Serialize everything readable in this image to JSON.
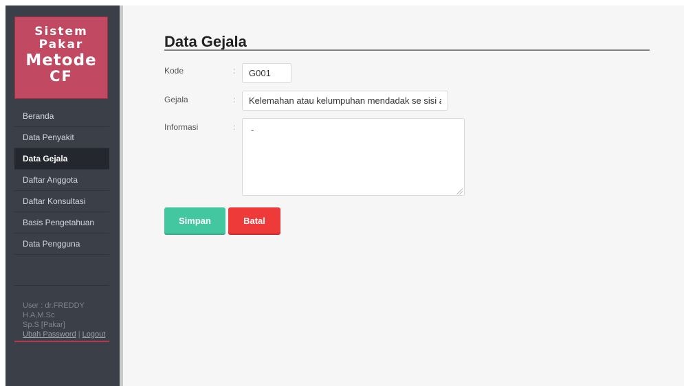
{
  "logo": {
    "line1": "Sistem",
    "line2": "Pakar",
    "line3": "Metode",
    "line4": "CF"
  },
  "sidebar": {
    "items": [
      {
        "label": "Beranda",
        "active": false
      },
      {
        "label": "Data Penyakit",
        "active": false
      },
      {
        "label": "Data Gejala",
        "active": true
      },
      {
        "label": "Daftar Anggota",
        "active": false
      },
      {
        "label": "Daftar Konsultasi",
        "active": false
      },
      {
        "label": "Basis Pengetahuan",
        "active": false
      },
      {
        "label": "Data Pengguna",
        "active": false
      }
    ],
    "user": {
      "line1": "User : dr.FREDDY H.A,M.Sc",
      "line2": "Sp.S [Pakar]",
      "change_password": "Ubah Password",
      "separator": "|",
      "logout": "Logout"
    }
  },
  "page": {
    "title": "Data Gejala",
    "form": {
      "kode_label": "Kode",
      "kode_value": "G001",
      "gejala_label": "Gejala",
      "gejala_value": "Kelemahan atau kelumpuhan mendadak se sisi anggota",
      "informasi_label": "Informasi",
      "informasi_value": "-",
      "colon": ":"
    },
    "buttons": {
      "save": "Simpan",
      "cancel": "Batal"
    }
  },
  "colors": {
    "sidebar_bg": "#3a3f48",
    "logo_bg": "#c14a62",
    "save_button": "#43c7a0",
    "cancel_button": "#ef3a3a"
  }
}
